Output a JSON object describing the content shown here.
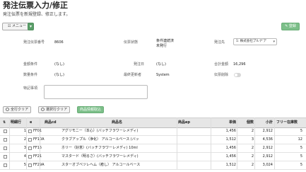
{
  "header": {
    "title": "発注伝票入力/修正",
    "subtitle": "発注伝票を新規登録、修正します。",
    "menu_label": "メニュー",
    "menu_caret": "▾",
    "register_label": "登録"
  },
  "form": {
    "slip_no_label": "発注伝票番号",
    "slip_no_value": "8606",
    "slip_status_label": "伝票状態",
    "slip_status_value": "条件連続済未発行",
    "supplier_label": "発注先",
    "supplier_value": "1: 株式会社プルナ'ア",
    "amount_condition_label": "金額条件",
    "amount_condition_value": "(なし)",
    "order_date_label": "発注日",
    "order_date_value": "(なし)",
    "total_label": "合計金額",
    "total_value": "16,296",
    "qty_condition_label": "数量条件",
    "qty_condition_value": "(なし)",
    "last_updated_by_label": "最終更新者",
    "last_updated_by_value": "System",
    "slip_delete_label": "伝票削除",
    "memo_label": "特記事項",
    "memo_value": ""
  },
  "actions": {
    "clear_all_label": "全行クリア",
    "clear_selected_label": "選択行クリア",
    "product_batch_label": "商品情報取込"
  },
  "table": {
    "headers": {
      "sort": "⇅",
      "line": "明細行",
      "e": "e",
      "code": "商品cd",
      "name": "商品名",
      "name_ep": "商品ep",
      "price": "単価",
      "qty": "個数",
      "subtotal": "小計",
      "stock": "フリー在庫数"
    },
    "rows": [
      {
        "line": "1",
        "code": "FF01",
        "name": "アグリモニー（本心）(バッチフラワーレメディ)",
        "price": "1,456",
        "qty": "2",
        "subtotal": "2,912",
        "stock": "5"
      },
      {
        "line": "2",
        "code": "FF10A",
        "name": "クラブアップル（浄化） アルコールベース (バッ",
        "price": "1,512",
        "qty": "3",
        "subtotal": "4,536",
        "stock": "12"
      },
      {
        "line": "3",
        "code": "FF15",
        "name": "ホリー（好意）(バッチフラワーレメディ) 10ml",
        "price": "1,456",
        "qty": "2",
        "subtotal": "2,912",
        "stock": "5"
      },
      {
        "line": "4",
        "code": "FF21",
        "name": "マスタード（明るさ）(バッチフラワーレメディ)",
        "price": "1,456",
        "qty": "2",
        "subtotal": "2,912",
        "stock": "5"
      },
      {
        "line": "5",
        "code": "FF29A",
        "name": "スターオブベツレヘム（癒し） アルコールベース",
        "price": "1,512",
        "qty": "2",
        "subtotal": "3,024",
        "stock": "5"
      }
    ]
  },
  "colors": {
    "accent_green": "#7cbf89",
    "header_bg": "#e6e6e6"
  }
}
